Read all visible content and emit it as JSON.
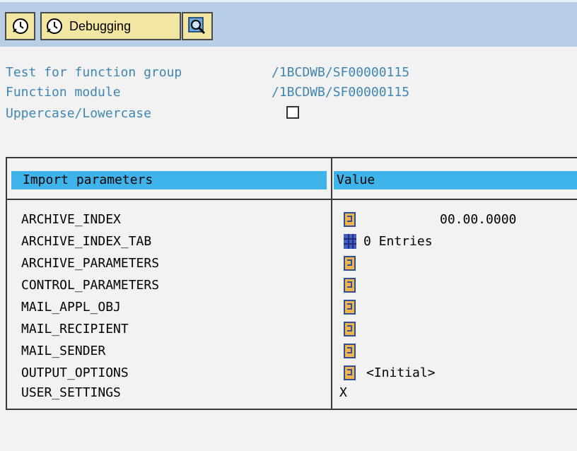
{
  "toolbar": {
    "execute_icon": "clock-execute-icon",
    "debug_label": "Debugging",
    "find_icon": "magnifier-icon"
  },
  "header_info": {
    "function_group_label": "Test for function group",
    "function_group_value": "/1BCDWB/SF00000115",
    "function_module_label": "Function module",
    "function_module_value": "/1BCDWB/SF00000115",
    "case_label": "Uppercase/Lowercase",
    "case_checked": false
  },
  "params_table": {
    "col_param": "Import parameters",
    "col_value": "Value",
    "rows": [
      {
        "name": "ARCHIVE_INDEX",
        "icon": "param-structure-icon",
        "value": "00.00.0000"
      },
      {
        "name": "ARCHIVE_INDEX_TAB",
        "icon": "table-icon",
        "value": "0 Entries"
      },
      {
        "name": "ARCHIVE_PARAMETERS",
        "icon": "param-structure-icon",
        "value": ""
      },
      {
        "name": "CONTROL_PARAMETERS",
        "icon": "param-structure-icon",
        "value": ""
      },
      {
        "name": "MAIL_APPL_OBJ",
        "icon": "param-structure-icon",
        "value": ""
      },
      {
        "name": "MAIL_RECIPIENT",
        "icon": "param-structure-icon",
        "value": ""
      },
      {
        "name": "MAIL_SENDER",
        "icon": "param-structure-icon",
        "value": ""
      },
      {
        "name": "OUTPUT_OPTIONS",
        "icon": "param-structure-icon",
        "value": "<Initial>"
      },
      {
        "name": "USER_SETTINGS",
        "icon": "",
        "value": "X"
      }
    ]
  },
  "colors": {
    "toolbar_bg": "#b7cee6",
    "button_bg": "#f3e6a2",
    "label_blue": "#3f86b5",
    "header_highlight": "#3fb4ea"
  }
}
